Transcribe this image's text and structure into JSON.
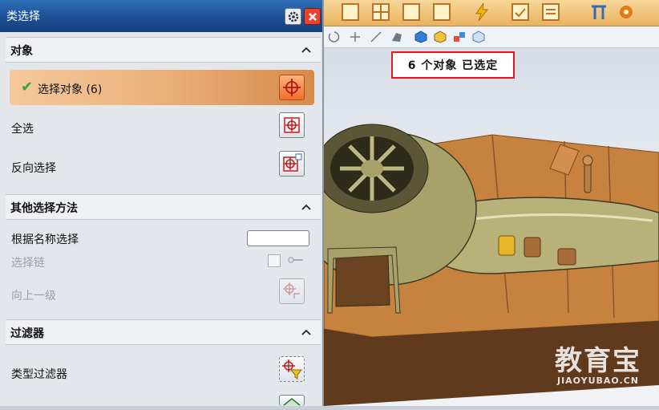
{
  "dialog": {
    "title": "类选择",
    "gear_icon": "gear-icon",
    "close_icon": "close-icon"
  },
  "sections": {
    "objects": {
      "title": "对象",
      "select_objects": "选择对象 (6)",
      "select_all": "全选",
      "invert_selection": "反向选择"
    },
    "other_methods": {
      "title": "其他选择方法",
      "select_by_name": "根据名称选择",
      "name_value": "",
      "select_chain": "选择链",
      "select_chain_checked": false,
      "up_one_level": "向上一级"
    },
    "filters": {
      "title": "过滤器",
      "type_filter": "类型过滤器"
    }
  },
  "viewport": {
    "status": "6 个对象 已选定"
  },
  "watermark": {
    "main": "教育宝",
    "sub": "JIAOYUBAO.CN"
  },
  "colors": {
    "title_bar": "#1d4f95",
    "selection_highlight": "#ebb07a",
    "status_border": "#e01a1a",
    "mold_orange": "#c7823f"
  }
}
